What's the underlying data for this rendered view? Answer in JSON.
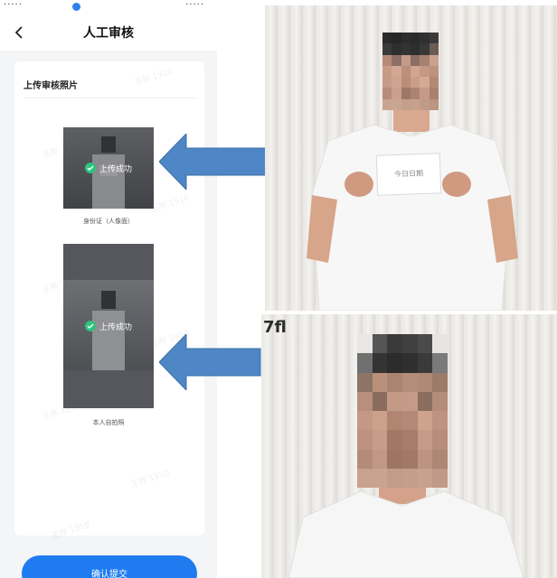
{
  "status_bar": {
    "left": "·····",
    "right": "·····"
  },
  "nav": {
    "title": "人工审核",
    "back_icon": "chevron-left-icon"
  },
  "card": {
    "title": "上传审核照片"
  },
  "uploads": [
    {
      "status": "上传成功",
      "caption": "身份证（人像面）"
    },
    {
      "status": "上传成功",
      "caption": "本人自拍照"
    }
  ],
  "watermarks": [
    "王桦 1910",
    "王桦 1910",
    "王桦 1910",
    "王桦 1910",
    "王桦 1910",
    "王桦 1910",
    "王桦 1910",
    "王桦 1910"
  ],
  "submit": {
    "label": "确认提交"
  },
  "reference_photos": {
    "top_paper_text": "今日日期",
    "bottom_logo": "7fl"
  },
  "colors": {
    "accent": "#1f7cf0",
    "success": "#2ec27e",
    "arrow": "#4f86c6"
  }
}
